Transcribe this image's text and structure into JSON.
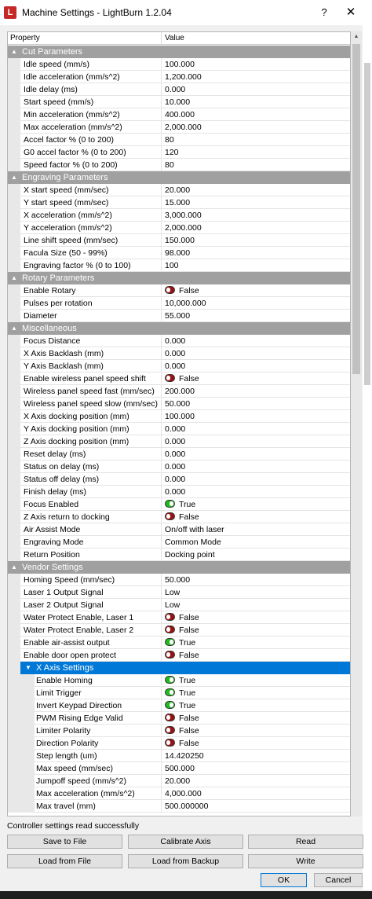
{
  "window": {
    "title": "Machine Settings - LightBurn 1.2.04",
    "app_icon_glyph": "L",
    "help_glyph": "?",
    "close_glyph": "✕"
  },
  "grid": {
    "header_property": "Property",
    "header_value": "Value"
  },
  "sections": [
    {
      "title": "Cut Parameters",
      "rows": [
        {
          "name": "Idle speed (mm/s)",
          "value": "100.000"
        },
        {
          "name": "Idle acceleration (mm/s^2)",
          "value": "1,200.000"
        },
        {
          "name": "Idle delay (ms)",
          "value": "0.000"
        },
        {
          "name": "Start speed (mm/s)",
          "value": "10.000"
        },
        {
          "name": "Min acceleration (mm/s^2)",
          "value": "400.000"
        },
        {
          "name": "Max acceleration (mm/s^2)",
          "value": "2,000.000"
        },
        {
          "name": "Accel factor % (0 to 200)",
          "value": "80"
        },
        {
          "name": "G0 accel factor % (0 to 200)",
          "value": "120"
        },
        {
          "name": "Speed factor % (0 to 200)",
          "value": "80"
        }
      ]
    },
    {
      "title": "Engraving Parameters",
      "rows": [
        {
          "name": "X start speed (mm/sec)",
          "value": "20.000"
        },
        {
          "name": "Y start speed (mm/sec)",
          "value": "15.000"
        },
        {
          "name": "X acceleration (mm/s^2)",
          "value": "3,000.000"
        },
        {
          "name": "Y acceleration (mm/s^2)",
          "value": "2,000.000"
        },
        {
          "name": "Line shift speed (mm/sec)",
          "value": "150.000"
        },
        {
          "name": "Facula Size (50 - 99%)",
          "value": "98.000"
        },
        {
          "name": "Engraving factor % (0 to 100)",
          "value": "100"
        }
      ]
    },
    {
      "title": "Rotary Parameters",
      "rows": [
        {
          "name": "Enable Rotary",
          "value": "False",
          "toggle": "off"
        },
        {
          "name": "Pulses per rotation",
          "value": "10,000.000"
        },
        {
          "name": "Diameter",
          "value": "55.000"
        }
      ]
    },
    {
      "title": "Miscellaneous",
      "rows": [
        {
          "name": "Focus Distance",
          "value": "0.000"
        },
        {
          "name": "X Axis Backlash (mm)",
          "value": "0.000"
        },
        {
          "name": "Y Axis Backlash (mm)",
          "value": "0.000"
        },
        {
          "name": "Enable wireless panel speed shift",
          "value": "False",
          "toggle": "off"
        },
        {
          "name": "Wireless panel speed fast (mm/sec)",
          "value": "200.000"
        },
        {
          "name": "Wireless panel speed slow (mm/sec)",
          "value": "50.000"
        },
        {
          "name": "X Axis docking position (mm)",
          "value": "100.000"
        },
        {
          "name": "Y Axis docking position (mm)",
          "value": "0.000"
        },
        {
          "name": "Z Axis docking position (mm)",
          "value": "0.000"
        },
        {
          "name": "Reset delay (ms)",
          "value": "0.000"
        },
        {
          "name": "Status on delay (ms)",
          "value": "0.000"
        },
        {
          "name": "Status off delay (ms)",
          "value": "0.000"
        },
        {
          "name": "Finish delay (ms)",
          "value": "0.000"
        },
        {
          "name": "Focus Enabled",
          "value": "True",
          "toggle": "on"
        },
        {
          "name": "Z Axis return to docking",
          "value": "False",
          "toggle": "off"
        },
        {
          "name": "Air Assist Mode",
          "value": "On/off with laser"
        },
        {
          "name": "Engraving Mode",
          "value": "Common Mode"
        },
        {
          "name": "Return Position",
          "value": "Docking point"
        }
      ]
    },
    {
      "title": "Vendor Settings",
      "rows": [
        {
          "name": "Homing Speed (mm/sec)",
          "value": "50.000"
        },
        {
          "name": "Laser 1 Output Signal",
          "value": "Low"
        },
        {
          "name": "Laser 2 Output Signal",
          "value": "Low"
        },
        {
          "name": "Water Protect Enable, Laser 1",
          "value": "False",
          "toggle": "off"
        },
        {
          "name": "Water Protect Enable, Laser 2",
          "value": "False",
          "toggle": "off"
        },
        {
          "name": "Enable air-assist output",
          "value": "True",
          "toggle": "on"
        },
        {
          "name": "Enable door open protect",
          "value": "False",
          "toggle": "off"
        }
      ]
    },
    {
      "title": "X Axis Settings",
      "sub": true,
      "selected": true,
      "rows": [
        {
          "name": "Enable Homing",
          "value": "True",
          "toggle": "on"
        },
        {
          "name": "Limit Trigger",
          "value": "True",
          "toggle": "on"
        },
        {
          "name": "Invert Keypad Direction",
          "value": "True",
          "toggle": "on"
        },
        {
          "name": "PWM Rising Edge Valid",
          "value": "False",
          "toggle": "off"
        },
        {
          "name": "Limiter Polarity",
          "value": "False",
          "toggle": "off"
        },
        {
          "name": "Direction Polarity",
          "value": "False",
          "toggle": "off"
        },
        {
          "name": "Step length (um)",
          "value": "14.420250"
        },
        {
          "name": "Max speed (mm/sec)",
          "value": "500.000"
        },
        {
          "name": "Jumpoff speed (mm/s^2)",
          "value": "20.000"
        },
        {
          "name": "Max acceleration (mm/s^2)",
          "value": "4,000.000"
        },
        {
          "name": "Max travel (mm)",
          "value": "500.000000"
        }
      ]
    }
  ],
  "status": "Controller settings read successfully",
  "buttons": {
    "save_to_file": "Save to File",
    "calibrate_axis": "Calibrate Axis",
    "read": "Read",
    "load_from_file": "Load from File",
    "load_from_backup": "Load from Backup",
    "write": "Write",
    "ok": "OK",
    "cancel": "Cancel"
  },
  "colors": {
    "section_bg": "#a0a0a0",
    "selected_bg": "#0078d7",
    "toggle_on": "#22b822",
    "toggle_off": "#9b1111"
  }
}
